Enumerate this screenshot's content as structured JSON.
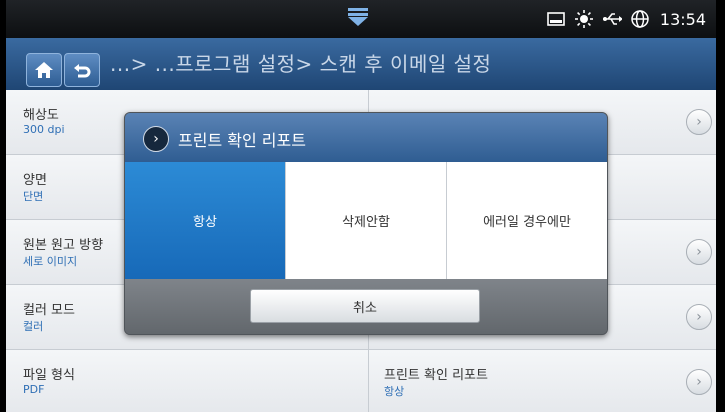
{
  "status_bar": {
    "icons": [
      "tray-icon",
      "sun-icon",
      "usb-icon",
      "globe-icon"
    ],
    "time": "13:54"
  },
  "header": {
    "breadcrumb": "...> ...프로그램 설정> 스캔 후 이메일 설정"
  },
  "settings": [
    {
      "label": "해상도",
      "value": "300 dpi"
    },
    {
      "label": "양면",
      "value": "단면"
    },
    {
      "label": "원본 원고 방향",
      "value": "세로 이미지"
    },
    {
      "label": "컬러 모드",
      "value": "컬러"
    },
    {
      "label": "파일 형식",
      "value": "PDF",
      "right_label": "프린트 확인 리포트",
      "right_value": "항상"
    }
  ],
  "dialog": {
    "title": "프린트 확인 리포트",
    "options": [
      "항상",
      "삭제안함",
      "에러일 경우에만"
    ],
    "selected": "항상",
    "cancel_label": "취소"
  },
  "colors": {
    "header": "#2c5a8e",
    "selected_option": "#1f7bc9",
    "value_text": "#2f6fb5"
  }
}
